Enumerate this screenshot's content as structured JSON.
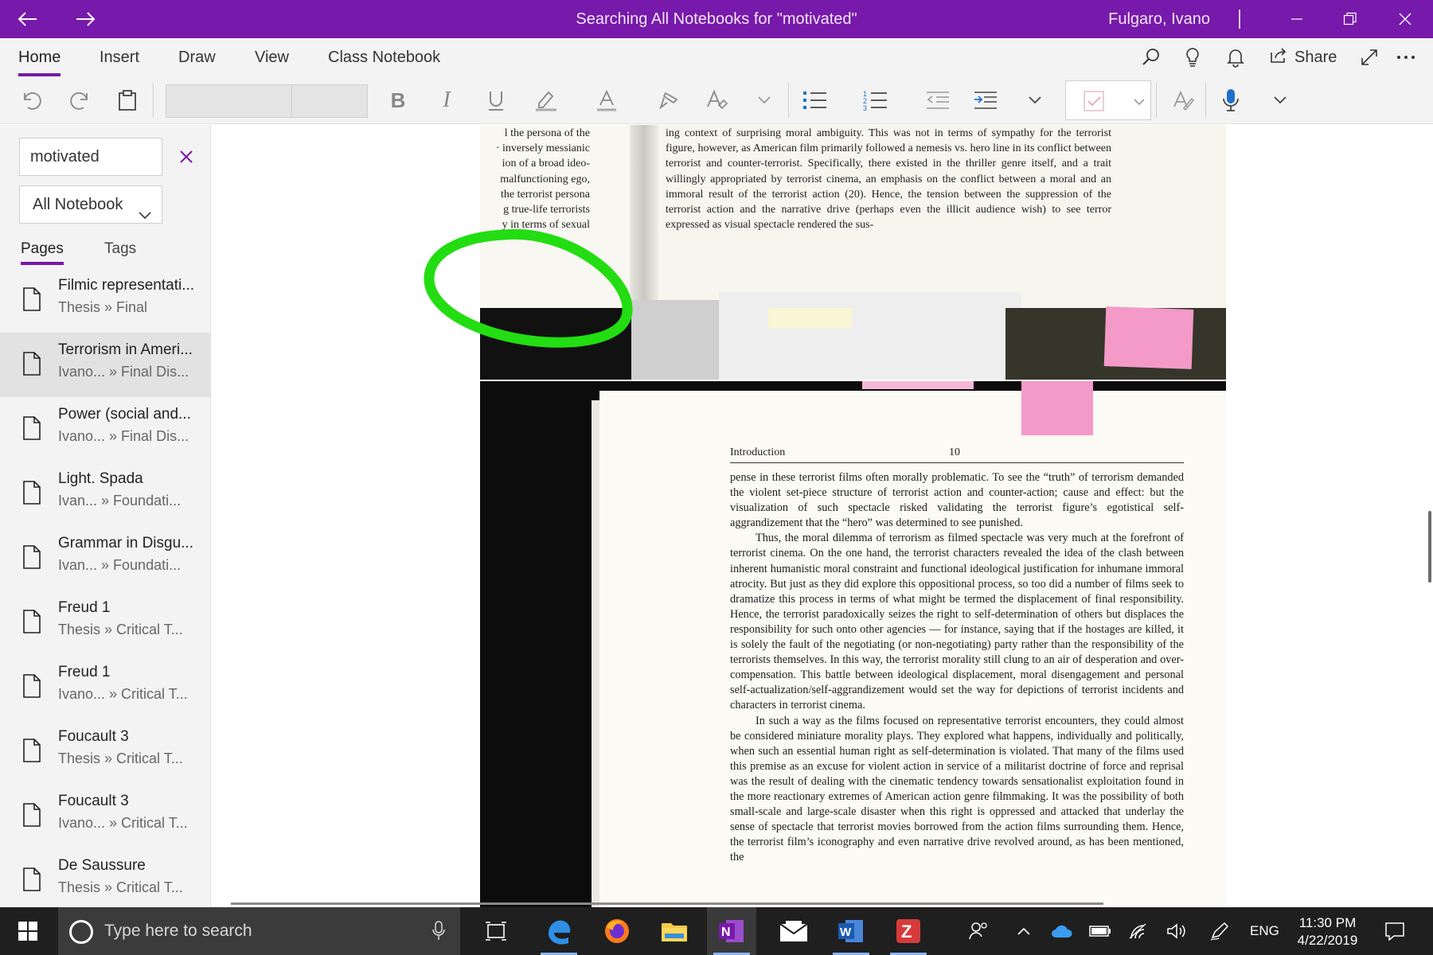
{
  "titlebar": {
    "title": "Searching All Notebooks for \"motivated\"",
    "user": "Fulgaro, Ivano",
    "icons": [
      "back-arrow-icon",
      "forward-arrow-icon",
      "minimize-icon",
      "restore-icon",
      "close-icon"
    ],
    "color": "#7719aa"
  },
  "ribbon": {
    "tabs": [
      "Home",
      "Insert",
      "Draw",
      "View",
      "Class Notebook"
    ],
    "active_tab": "Home",
    "share_label": "Share",
    "right_icons": [
      "search-icon",
      "lightbulb-icon",
      "bell-icon",
      "share-icon",
      "fullscreen-icon",
      "more-icon"
    ]
  },
  "toolbar": {
    "icons": [
      "undo-icon",
      "redo-icon",
      "clipboard-icon",
      "bold-icon",
      "italic-icon",
      "underline-icon",
      "highlight-icon",
      "font-color-icon",
      "format-painter-icon",
      "clear-formatting-icon",
      "chevron-down-icon",
      "bullets-icon",
      "numbering-icon",
      "outdent-icon",
      "indent-icon",
      "chevron-down-icon",
      "todo-tag-icon",
      "tag-chevron-icon",
      "ink-to-text-icon",
      "dictate-mic-icon",
      "chevron-down-icon"
    ],
    "font_name": "",
    "font_size": ""
  },
  "search": {
    "query": "motivated",
    "scope": "All Notebook",
    "tabs": [
      "Pages",
      "Tags"
    ],
    "active_tab": "Pages",
    "results": [
      {
        "title": "Filmic representati...",
        "path": "Thesis » Final",
        "selected": false
      },
      {
        "title": "Terrorism in Ameri...",
        "path": "Ivano... » Final Dis...",
        "selected": true
      },
      {
        "title": "Power (social and...",
        "path": "Ivano... » Final Dis...",
        "selected": false
      },
      {
        "title": "Light. Spada",
        "path": "Ivan... » Foundati...",
        "selected": false
      },
      {
        "title": "Grammar in Disgu...",
        "path": "Ivan... » Foundati...",
        "selected": false
      },
      {
        "title": "Freud 1",
        "path": "Thesis » Critical T...",
        "selected": false
      },
      {
        "title": "Freud 1",
        "path": "Ivano... » Critical T...",
        "selected": false
      },
      {
        "title": "Foucault 3",
        "path": "Thesis » Critical T...",
        "selected": false
      },
      {
        "title": "Foucault 3",
        "path": "Ivano... » Critical T...",
        "selected": false
      },
      {
        "title": "De Saussure",
        "path": "Thesis » Critical T...",
        "selected": false
      }
    ]
  },
  "document": {
    "top_left_lines": "l the persona of the\n· inversely messianic\nion of a broad ideo-\nmalfunctioning ego,\nthe terrorist persona\ng true-life terrorists\ny in terms of sexual",
    "top_right_text": "ing context of surprising moral ambiguity. This was not in terms of sympathy for the terrorist figure, however, as American film primarily followed a nemesis vs. hero line in its conflict between terrorist and counter-terrorist. Specifically, there existed in the thriller genre itself, and a trait willingly appropriated by terrorist cinema, an emphasis on the conflict between a moral and an immoral result of the terrorist action (20). Hence, the tension between the suppression of the terrorist action and the narrative drive (perhaps even the illicit audience wish) to see terror expressed as visual spectacle rendered the sus-",
    "running_head": "Introduction",
    "page_number": "10",
    "paragraphs": [
      "pense in these terrorist films often morally problematic. To see the “truth” of terrorism demanded the violent set-piece structure of terrorist action and counter-action; cause and effect: but the visualization of such spectacle risked validating the terrorist figure’s egotistical self-aggrandizement that the “hero” was determined to see punished.",
      "Thus, the moral dilemma of terrorism as filmed spectacle was very much at the forefront of terrorist cinema. On the one hand, the terrorist characters revealed the idea of the clash between inherent humanistic moral constraint and functional ideological justification for inhumane immoral atrocity. But just as they did explore this oppositional process, so too did a number of films seek to dramatize this process in terms of what might be termed the displacement of final responsibility. Hence, the terrorist paradoxically seizes the right to self-determination of others but displaces the responsibility for such onto other agencies — for instance, saying that if the hostages are killed, it is solely the fault of the negotiating (or non-negotiating) party rather than the responsibility of the terrorists themselves. In this way, the terrorist morality still clung to an air of desperation and over-compensation. This battle between ideological displacement, moral disengagement and personal self-actualization/self-aggrandizement would set the way for depictions of terrorist incidents and characters in terrorist cinema.",
      "In such a way as the films focused on representative terrorist encounters, they could almost be considered miniature morality plays. They explored what happens, individually and politically, when such an essential human right as self-determination is violated. That many of the films used this premise as an excuse for violent action in service of a militarist doctrine of force and reprisal was the result of dealing with the cinematic tendency towards sensationalist exploitation found in the more reactionary extremes of American action genre filmmaking. It was the possibility of both small-scale and large-scale disaster when this right is oppressed and attacked that underlay the sense of spectacle that terrorist movies borrowed from the action films surrounding them. Hence, the terrorist film’s iconography and even narrative drive revolved around, as has been mentioned, the"
    ],
    "ink_color": "#22dd11"
  },
  "taskbar": {
    "search_placeholder": "Type here to search",
    "apps": [
      "windows-start-icon",
      "cortana-icon",
      "task-view-icon",
      "edge-icon",
      "firefox-icon",
      "file-explorer-icon",
      "onenote-icon",
      "mail-icon",
      "word-icon",
      "zotero-icon"
    ],
    "tray_icons": [
      "people-icon",
      "chevron-up-icon",
      "onedrive-icon",
      "battery-icon",
      "wifi-icon",
      "volume-icon",
      "pen-icon",
      "notifications-icon"
    ],
    "language": "ENG",
    "time": "11:30 PM",
    "date": "4/22/2019"
  }
}
